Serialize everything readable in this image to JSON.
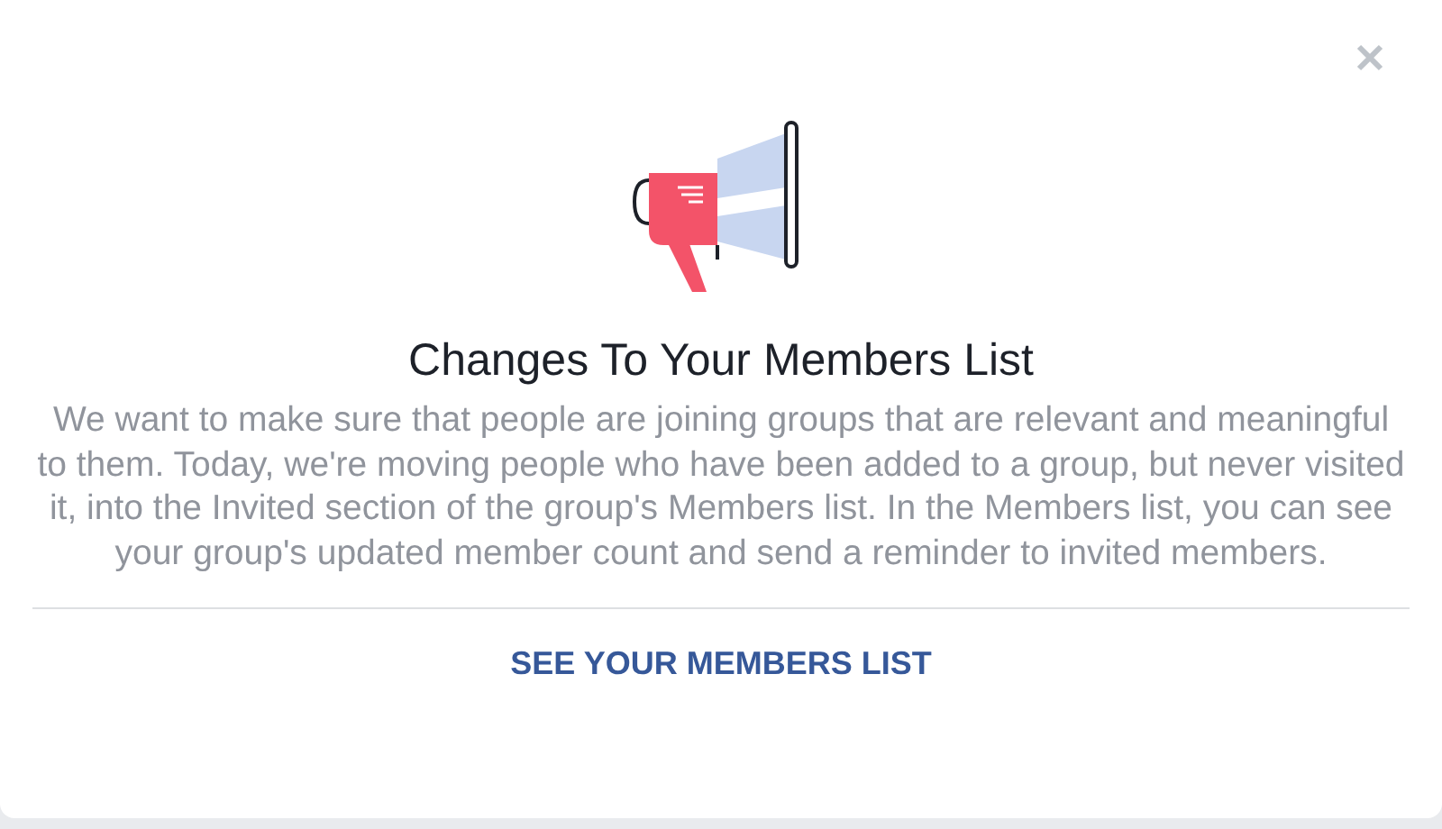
{
  "dialog": {
    "title": "Changes To Your Members List",
    "body": "We want to make sure that people are joining groups that are relevant and meaningful to them. Today, we're moving people who have been added to a group, but never visited it, into the Invited section of the group's Members list. In the Members list, you can see your group's updated member count and send a reminder to invited members.",
    "action": "SEE YOUR MEMBERS LIST"
  }
}
